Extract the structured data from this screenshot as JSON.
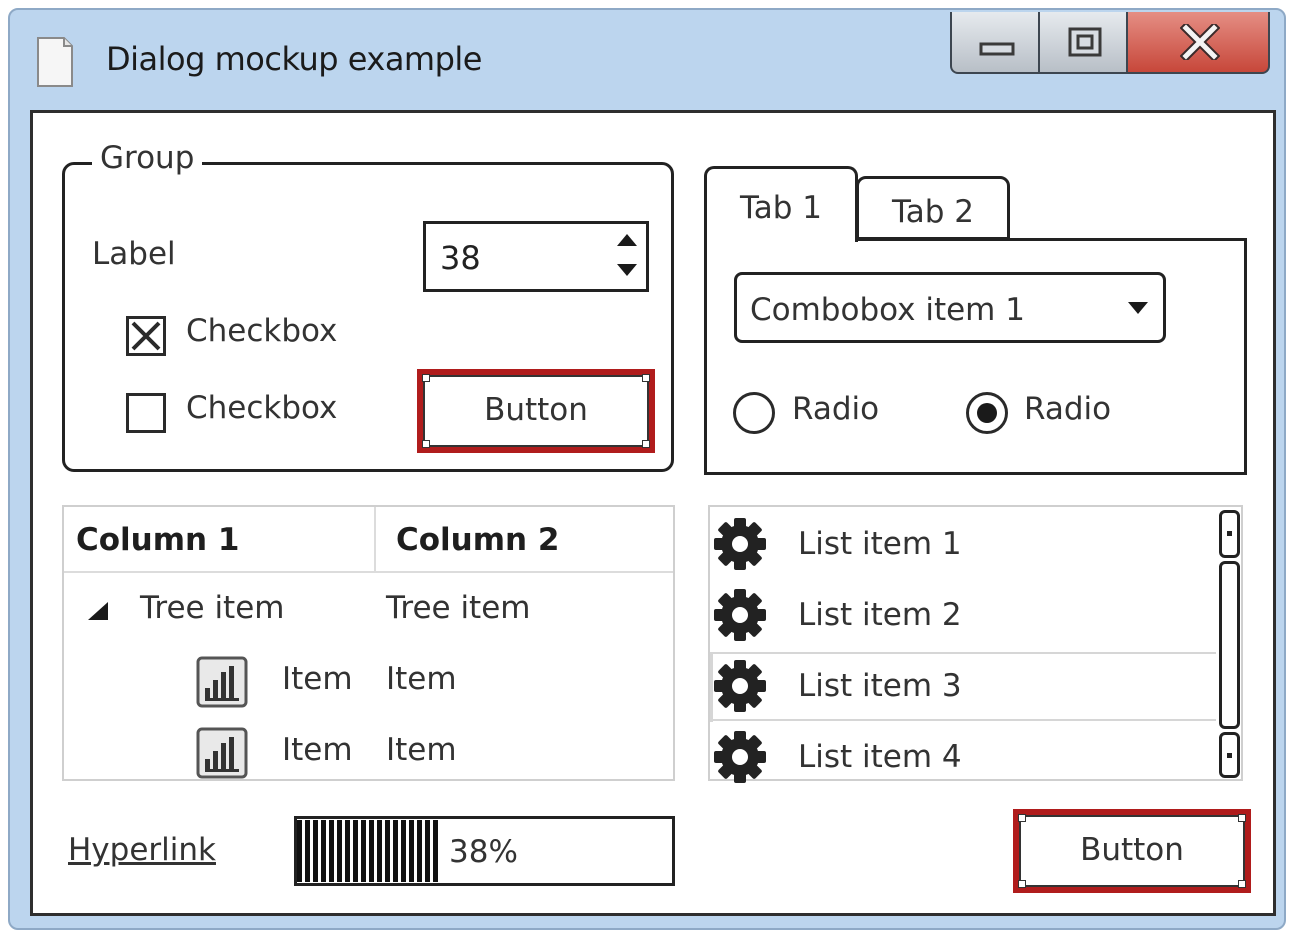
{
  "window": {
    "title": "Dialog mockup example",
    "icons": {
      "app": "document-icon",
      "minimize": "minimize-icon",
      "maximize": "maximize-icon",
      "close": "close-icon"
    },
    "colors": {
      "frame": "#bcd5ee",
      "close_button": "#c7473a",
      "selection_border": "#b01c1c"
    }
  },
  "group": {
    "title": "Group",
    "label": "Label",
    "spinner_value": "38",
    "checkbox1": {
      "label": "Checkbox",
      "checked": true
    },
    "checkbox2": {
      "label": "Checkbox",
      "checked": false
    },
    "button_label": "Button"
  },
  "tabs": {
    "items": [
      {
        "label": "Tab 1",
        "active": true
      },
      {
        "label": "Tab 2",
        "active": false
      }
    ],
    "combobox_value": "Combobox item 1",
    "radio1": {
      "label": "Radio",
      "selected": false
    },
    "radio2": {
      "label": "Radio",
      "selected": true
    }
  },
  "tree": {
    "columns": [
      "Column 1",
      "Column 2"
    ],
    "rows": [
      {
        "col1": "Tree item",
        "col2": "Tree item",
        "icon": "expand-triangle-icon"
      },
      {
        "col1": "Item",
        "col2": "Item",
        "icon": "bar-chart-icon"
      },
      {
        "col1": "Item",
        "col2": "Item",
        "icon": "bar-chart-icon"
      }
    ]
  },
  "list": {
    "items": [
      {
        "label": "List item 1",
        "icon": "gear-icon"
      },
      {
        "label": "List item 2",
        "icon": "gear-icon"
      },
      {
        "label": "List item 3",
        "icon": "gear-icon"
      },
      {
        "label": "List item 4",
        "icon": "gear-icon"
      }
    ]
  },
  "footer": {
    "hyperlink": "Hyperlink",
    "progress_percent": 38,
    "progress_text": "38%",
    "button_label": "Button"
  }
}
